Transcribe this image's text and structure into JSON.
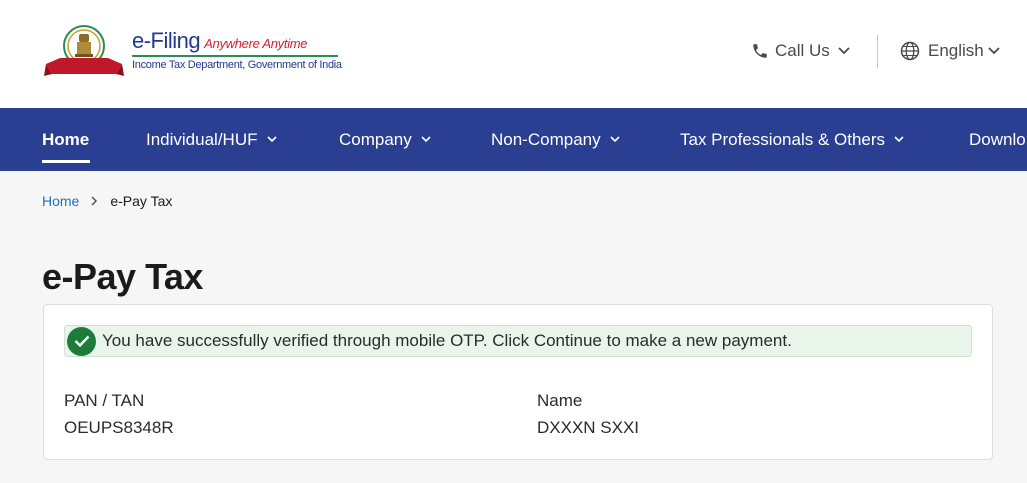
{
  "header": {
    "brand_title": "e-Filing",
    "brand_tagline": "Anywhere Anytime",
    "brand_subtitle": "Income Tax Department, Government of India",
    "logo_text": "INCOME TAX DEPARTMENT",
    "call_us_label": "Call Us",
    "language_label": "English"
  },
  "nav": {
    "items": [
      {
        "label": "Home",
        "active": true
      },
      {
        "label": "Individual/HUF"
      },
      {
        "label": "Company"
      },
      {
        "label": "Non-Company"
      },
      {
        "label": "Tax Professionals & Others"
      },
      {
        "label": "Downlo"
      }
    ]
  },
  "breadcrumb": {
    "home": "Home",
    "current": "e-Pay Tax"
  },
  "page": {
    "title": "e-Pay Tax"
  },
  "card": {
    "success_message": "You have successfully verified through mobile OTP. Click Continue to make a new payment.",
    "pan_label": "PAN / TAN",
    "pan_value": "OEUPS8348R",
    "name_label": "Name",
    "name_value": "DXXXN SXXI"
  },
  "colors": {
    "nav_bg": "#2a3e92",
    "link": "#1f6fb8",
    "success_bg": "#e9f4eb",
    "success_icon": "#1e7c3a",
    "brand_blue": "#1f3a93",
    "brand_red": "#d0202f"
  }
}
